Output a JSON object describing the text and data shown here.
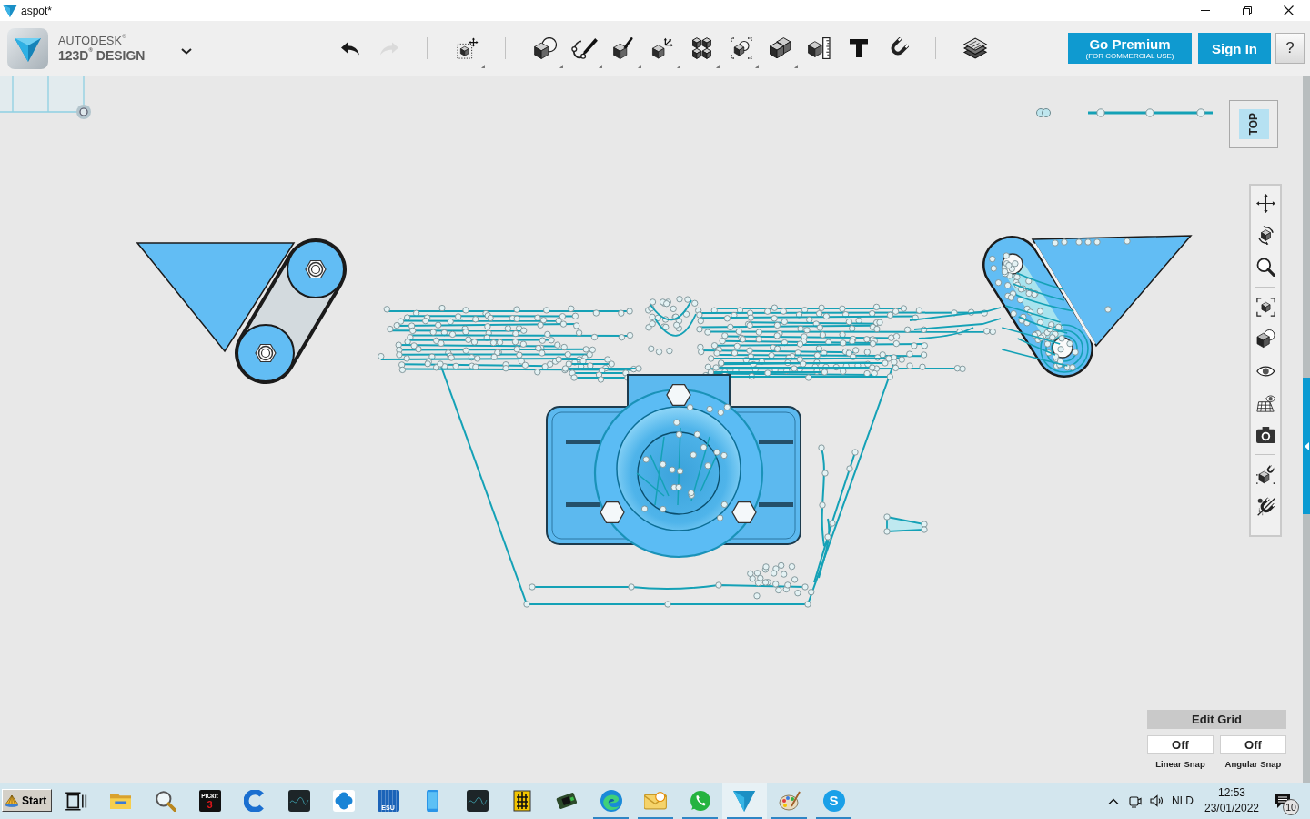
{
  "window": {
    "title": "aspot*",
    "controls": [
      {
        "kind": "minimize"
      },
      {
        "kind": "restore"
      },
      {
        "kind": "close"
      }
    ]
  },
  "app_header": {
    "brand": "AUTODESK$^{®}$",
    "product": "123D$^{®}$ DESIGN"
  },
  "toolbar": {
    "groups": [
      {
        "items": [
          {
            "kind": "undo",
            "disabled": false,
            "menu": false
          },
          {
            "kind": "redo",
            "disabled": true,
            "menu": false
          }
        ]
      },
      {
        "items": [
          {
            "kind": "transform",
            "disabled": false,
            "menu": true
          }
        ]
      },
      {
        "items": [
          {
            "kind": "primitives",
            "disabled": false,
            "menu": true
          },
          {
            "kind": "sketch",
            "disabled": false,
            "menu": true
          },
          {
            "kind": "construct",
            "disabled": false,
            "menu": true
          },
          {
            "kind": "modify",
            "disabled": false,
            "menu": true
          },
          {
            "kind": "pattern",
            "disabled": false,
            "menu": true
          },
          {
            "kind": "grouping",
            "disabled": false,
            "menu": true
          },
          {
            "kind": "combine",
            "disabled": false,
            "menu": true
          },
          {
            "kind": "measure",
            "disabled": false,
            "menu": false
          },
          {
            "kind": "text",
            "disabled": false,
            "menu": false
          },
          {
            "kind": "snap",
            "disabled": false,
            "menu": false
          }
        ]
      },
      {
        "items": [
          {
            "kind": "materials",
            "disabled": false,
            "menu": false
          }
        ]
      }
    ]
  },
  "account": {
    "premium": {
      "label": "Go Premium",
      "note": "(FOR COMMERCIAL USE)"
    },
    "sign_in": "Sign In",
    "help": "?"
  },
  "view_cube": {
    "face": "TOP"
  },
  "navigation_bar": {
    "groups": [
      {
        "tools": [
          {
            "kind": "pan"
          },
          {
            "kind": "orbit"
          },
          {
            "kind": "zoom"
          }
        ]
      },
      {
        "tools": [
          {
            "kind": "fit"
          },
          {
            "kind": "view_mode"
          },
          {
            "kind": "visibility"
          },
          {
            "kind": "grid_visibility"
          },
          {
            "kind": "snapshot"
          }
        ]
      },
      {
        "tools": [
          {
            "kind": "snap_to"
          },
          {
            "kind": "magnet_off"
          }
        ]
      }
    ]
  },
  "grid_panel": {
    "title": "Edit Grid",
    "snaps": [
      {
        "value": "Off",
        "label": "Linear Snap"
      },
      {
        "value": "Off",
        "label": "Angular Snap"
      }
    ]
  },
  "taskbar": {
    "start": "Start",
    "apps": [
      {
        "kind": "task_view",
        "running": false,
        "selected": false
      },
      {
        "kind": "folder",
        "running": false,
        "selected": false
      },
      {
        "kind": "search",
        "running": false,
        "selected": false
      },
      {
        "kind": "pickit",
        "label": "PICkit",
        "badge": "3",
        "running": false,
        "selected": false
      },
      {
        "kind": "cleaner",
        "running": false,
        "selected": false
      },
      {
        "kind": "scope",
        "running": false,
        "selected": false
      },
      {
        "kind": "clover",
        "running": false,
        "selected": false
      },
      {
        "kind": "esu",
        "label": "ESU",
        "running": false,
        "selected": false
      },
      {
        "kind": "phone",
        "running": false,
        "selected": false
      },
      {
        "kind": "scope",
        "running": false,
        "selected": false
      },
      {
        "kind": "building",
        "running": false,
        "selected": false
      },
      {
        "kind": "board",
        "running": false,
        "selected": false
      },
      {
        "kind": "edge",
        "running": true,
        "selected": false
      },
      {
        "kind": "mail",
        "running": true,
        "selected": false
      },
      {
        "kind": "whatsapp",
        "running": true,
        "selected": false
      },
      {
        "kind": "design",
        "running": true,
        "selected": true
      },
      {
        "kind": "paint",
        "running": true,
        "selected": false
      },
      {
        "kind": "skype",
        "label": "S",
        "running": true,
        "selected": false
      }
    ],
    "tray": {
      "language": "NLD",
      "time": "12:53",
      "date": "23/01/2022",
      "notifications": "10"
    }
  }
}
